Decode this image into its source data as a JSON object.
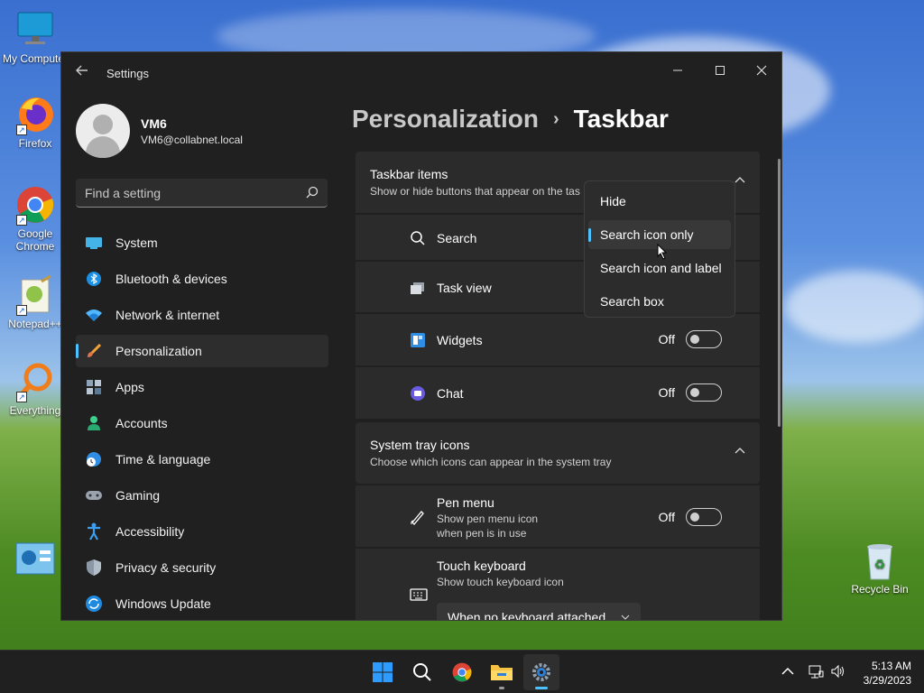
{
  "desktop": {
    "icons": [
      {
        "label": "My Computer"
      },
      {
        "label": "Firefox"
      },
      {
        "label": "Google Chrome"
      },
      {
        "label": "Notepad++"
      },
      {
        "label": "Everything"
      },
      {
        "label": ""
      },
      {
        "label": "Recycle Bin"
      }
    ]
  },
  "window": {
    "title": "Settings",
    "profile": {
      "name": "VM6",
      "email": "VM6@collabnet.local"
    },
    "search": {
      "placeholder": "Find a setting"
    },
    "nav": [
      {
        "label": "System",
        "icon": "system-icon"
      },
      {
        "label": "Bluetooth & devices",
        "icon": "bluetooth-icon"
      },
      {
        "label": "Network & internet",
        "icon": "wifi-icon"
      },
      {
        "label": "Personalization",
        "icon": "brush-icon",
        "active": true
      },
      {
        "label": "Apps",
        "icon": "apps-icon"
      },
      {
        "label": "Accounts",
        "icon": "accounts-icon"
      },
      {
        "label": "Time & language",
        "icon": "clock-globe-icon"
      },
      {
        "label": "Gaming",
        "icon": "gamepad-icon"
      },
      {
        "label": "Accessibility",
        "icon": "accessibility-icon"
      },
      {
        "label": "Privacy & security",
        "icon": "shield-icon"
      },
      {
        "label": "Windows Update",
        "icon": "update-icon"
      }
    ],
    "breadcrumb": {
      "parent": "Personalization",
      "separator": "›",
      "current": "Taskbar"
    },
    "taskbar_items": {
      "title": "Taskbar items",
      "subtitle": "Show or hide buttons that appear on the tas",
      "rows": [
        {
          "label": "Search"
        },
        {
          "label": "Task view"
        },
        {
          "label": "Widgets",
          "state": "Off"
        },
        {
          "label": "Chat",
          "state": "Off"
        }
      ]
    },
    "system_tray": {
      "title": "System tray icons",
      "subtitle": "Choose which icons can appear in the system tray",
      "pen": {
        "label": "Pen menu",
        "sub1": "Show pen menu icon",
        "sub2": "when pen is in use",
        "state": "Off"
      },
      "touch": {
        "label": "Touch keyboard",
        "sub": "Show touch keyboard icon",
        "combo": "When no keyboard attached"
      }
    },
    "dropdown": {
      "options": [
        "Hide",
        "Search icon only",
        "Search icon and label",
        "Search box"
      ],
      "selected": "Search icon only"
    }
  },
  "taskbar": {
    "time": "5:13 AM",
    "date": "3/29/2023"
  },
  "colors": {
    "accent": "#4cc2ff",
    "window_bg": "#202020",
    "card_bg": "#2b2b2b"
  }
}
